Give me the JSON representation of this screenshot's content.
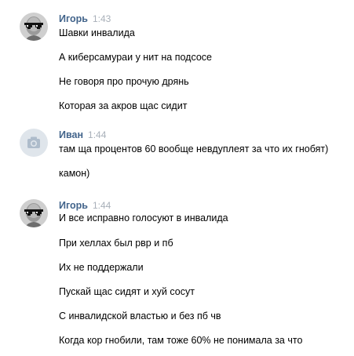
{
  "groups": [
    {
      "author": "Игорь",
      "time": "1:43",
      "avatar_icon": "sunglasses-avatar-icon",
      "messages": [
        "Шавки инвалида",
        "А киберсамураи у нит на подсосе",
        "Не говоря про прочую дрянь",
        "Которая за акров щас сидит"
      ]
    },
    {
      "author": "Иван",
      "time": "1:44",
      "avatar_icon": "camera-icon",
      "messages": [
        "там ща процентов 60 вообще невдуплеят за что их гнобят)",
        "камон)"
      ]
    },
    {
      "author": "Игорь",
      "time": "1:44",
      "avatar_icon": "sunglasses-avatar-icon",
      "messages": [
        "И все исправно голосуют в инвалида",
        "При хеллах был рвр и пб",
        "Их не поддержали",
        "Пускай щас сидят и хуй сосут",
        "С инвалидской властью и без пб чв",
        "Когда кор гнобили, там тоже 60% не понимала за что"
      ]
    }
  ],
  "colors": {
    "author_link": "#42648b",
    "timestamp": "#a8b0b9",
    "text": "#000000",
    "camera_avatar_bg": "#dfe5eb",
    "camera_icon": "#aebccb"
  }
}
